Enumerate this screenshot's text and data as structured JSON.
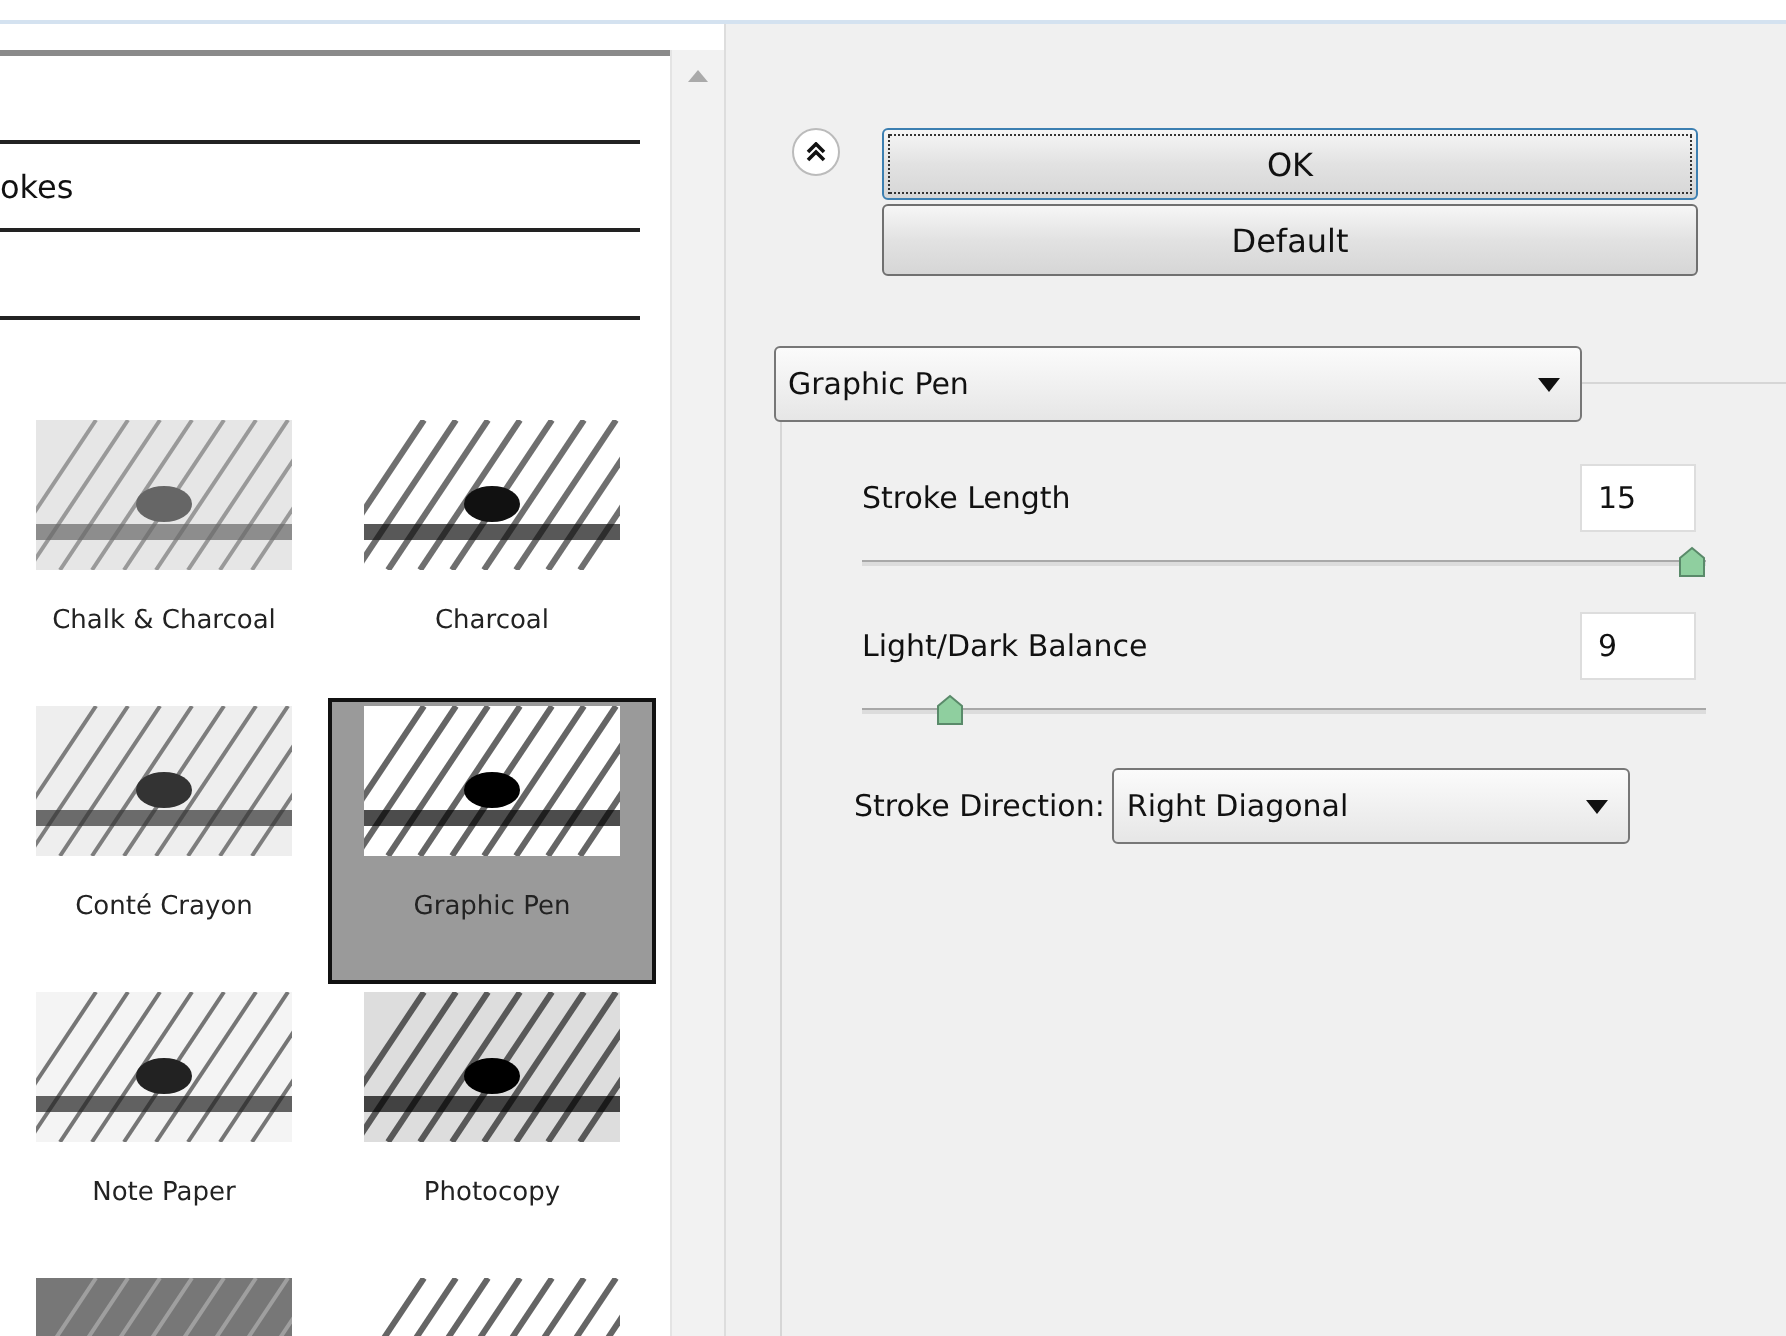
{
  "filter_gallery": {
    "category_label": "okes",
    "thumbnails": [
      {
        "label": "Chalk & Charcoal",
        "selected": false
      },
      {
        "label": "Charcoal",
        "selected": false
      },
      {
        "label": "Conté Crayon",
        "selected": false
      },
      {
        "label": "Graphic Pen",
        "selected": true
      },
      {
        "label": "Note Paper",
        "selected": false
      },
      {
        "label": "Photocopy",
        "selected": false
      },
      {
        "selected": false
      },
      {
        "selected": false
      }
    ]
  },
  "buttons": [
    {
      "label": "OK",
      "focused": true
    },
    {
      "label": "Default",
      "focused": false
    }
  ],
  "filter_select": {
    "value": "Graphic Pen"
  },
  "sliders": [
    {
      "label": "Stroke Length",
      "value": "15",
      "level": 1.0
    },
    {
      "label": "Light/Dark Balance",
      "value": "9",
      "level": 0.09
    }
  ],
  "stroke_direction": {
    "label": "Stroke Direction:",
    "value": "Right Diagonal"
  }
}
